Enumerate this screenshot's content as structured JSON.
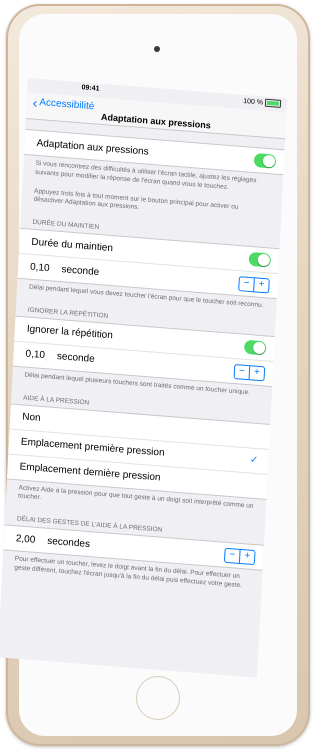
{
  "status": {
    "time": "09:41",
    "battery": "100 %"
  },
  "nav": {
    "back": "Accessibilité",
    "title": "Adaptation aux pressions"
  },
  "main_toggle": {
    "label": "Adaptation aux pressions",
    "on": true
  },
  "intro_footer": "Si vous rencontrez des difficultés à utiliser l'écran tactile, ajustez les réglages suivants pour modifier la réponse de l'écran quand vous le touchez.",
  "intro_footer2": "Appuyez trois fois à tout moment sur le bouton principal pour activer ou désactiver Adaptation aux pressions.",
  "hold": {
    "header": "DURÉE DU MAINTIEN",
    "label": "Durée du maintien",
    "value": "0,10",
    "unit": "seconde",
    "footer": "Délai pendant lequel vous devez toucher l'écran pour que le toucher soit reconnu."
  },
  "repeat": {
    "header": "IGNORER LA RÉPÉTITION",
    "label": "Ignorer la répétition",
    "value": "0,10",
    "unit": "seconde",
    "footer": "Délai pendant lequel plusieurs touchers sont traités comme un toucher unique."
  },
  "assist": {
    "header": "AIDE À LA PRESSION",
    "options": [
      "Non",
      "Emplacement première pression",
      "Emplacement dernière pression"
    ],
    "footer": "Activez Aide à la pression pour que tout geste à un doigt soit interprété comme un toucher."
  },
  "delay": {
    "header": "DÉLAI DES GESTES DE L'AIDE À LA PRESSION",
    "value": "2,00",
    "unit": "secondes",
    "footer": "Pour effectuer un toucher, levez le doigt avant la fin du délai. Pour effectuer un geste différent, touchez l'écran jusqu'à la fin du délai puis effectuez votre geste."
  },
  "stepper": {
    "minus": "−",
    "plus": "+"
  },
  "icons": {
    "checkmark": "✓"
  },
  "colors": {
    "accent": "#007aff",
    "toggle_on": "#4cd964",
    "device": "#e6d6c2"
  }
}
